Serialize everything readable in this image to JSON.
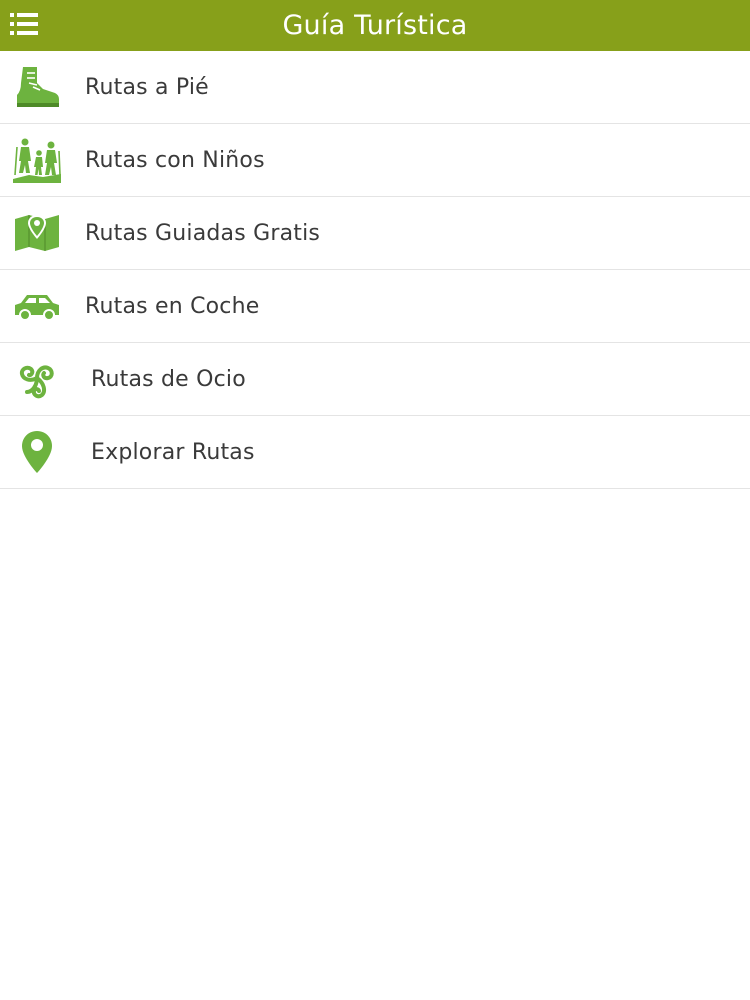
{
  "header": {
    "title": "Guía Turística",
    "menu_icon": "hamburger-list-icon"
  },
  "colors": {
    "header_bg": "#87a01a",
    "icon_green": "#6db33f",
    "text": "#3a3a3a",
    "divider": "#e4e4e4"
  },
  "menu": {
    "items": [
      {
        "label": "Rutas a Pié",
        "icon": "hiking-boot-icon"
      },
      {
        "label": "Rutas con Niños",
        "icon": "family-hiking-icon"
      },
      {
        "label": "Rutas Guiadas Gratis",
        "icon": "map-pin-icon"
      },
      {
        "label": "Rutas en Coche",
        "icon": "car-icon"
      },
      {
        "label": "Rutas de Ocio",
        "icon": "triskelion-icon"
      },
      {
        "label": "Explorar Rutas",
        "icon": "location-pin-icon"
      }
    ]
  }
}
